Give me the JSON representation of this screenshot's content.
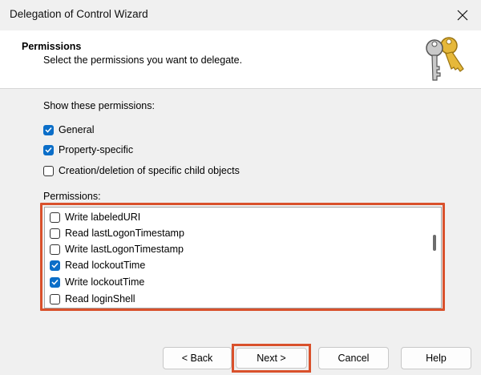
{
  "window": {
    "title": "Delegation of Control Wizard"
  },
  "header": {
    "title": "Permissions",
    "subtitle": "Select the permissions you want to delegate."
  },
  "show_permissions": {
    "label": "Show these permissions:",
    "options": [
      {
        "label": "General",
        "checked": true
      },
      {
        "label": "Property-specific",
        "checked": true
      },
      {
        "label": "Creation/deletion of specific child objects",
        "checked": false
      }
    ]
  },
  "permissions": {
    "label": "Permissions:",
    "items": [
      {
        "label": "Write labeledURI",
        "checked": false
      },
      {
        "label": "Read lastLogonTimestamp",
        "checked": false
      },
      {
        "label": "Write lastLogonTimestamp",
        "checked": false
      },
      {
        "label": "Read lockoutTime",
        "checked": true
      },
      {
        "label": "Write lockoutTime",
        "checked": true
      },
      {
        "label": "Read loginShell",
        "checked": false
      }
    ]
  },
  "buttons": {
    "back": "< Back",
    "next": "Next >",
    "cancel": "Cancel",
    "help": "Help"
  },
  "colors": {
    "checkbox_checked": "#0b6ec8",
    "highlight_border": "#d9512c"
  },
  "icons": {
    "header": "keys-icon",
    "close": "close-icon"
  }
}
